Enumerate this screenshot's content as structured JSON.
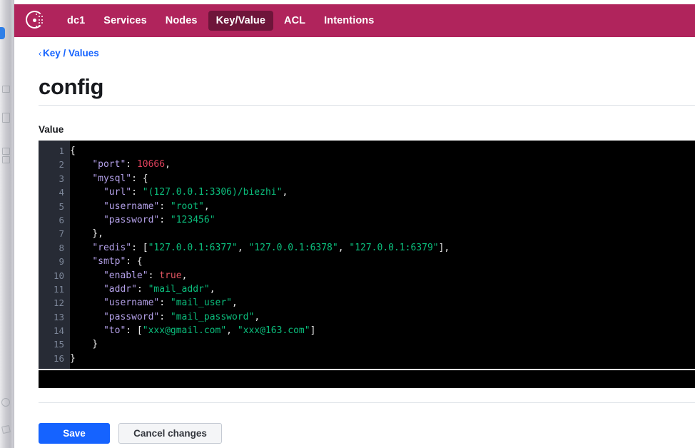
{
  "app": {
    "logo_icon": "consul-logo-icon",
    "brand_color": "#b0245c",
    "active_nav_color": "#6e153a",
    "accent_color": "#1563ff"
  },
  "nav": {
    "items": [
      {
        "label": "dc1",
        "active": false
      },
      {
        "label": "Services",
        "active": false
      },
      {
        "label": "Nodes",
        "active": false
      },
      {
        "label": "Key/Value",
        "active": true
      },
      {
        "label": "ACL",
        "active": false
      },
      {
        "label": "Intentions",
        "active": false
      }
    ]
  },
  "breadcrumb": {
    "chevron_icon": "chevron-left-icon",
    "label": "Key / Values"
  },
  "page": {
    "title": "config",
    "value_label": "Value"
  },
  "editor": {
    "background": "#000000",
    "gutter_background": "#272b35",
    "line_count": 16,
    "line_numbers": [
      "1",
      "2",
      "3",
      "4",
      "5",
      "6",
      "7",
      "8",
      "9",
      "10",
      "11",
      "12",
      "13",
      "14",
      "15",
      "16"
    ],
    "colors": {
      "punctuation": "#e8e8e8",
      "key": "#b3a0e8",
      "string": "#0bbf7d",
      "number": "#e0415c",
      "boolean": "#e05561",
      "line_number": "#7d8799"
    },
    "lines": [
      [
        {
          "t": "{",
          "c": "punc"
        }
      ],
      [
        {
          "t": "    ",
          "c": "punc"
        },
        {
          "t": "\"port\"",
          "c": "key"
        },
        {
          "t": ": ",
          "c": "punc"
        },
        {
          "t": "10666",
          "c": "num"
        },
        {
          "t": ",",
          "c": "punc"
        }
      ],
      [
        {
          "t": "    ",
          "c": "punc"
        },
        {
          "t": "\"mysql\"",
          "c": "key"
        },
        {
          "t": ": {",
          "c": "punc"
        }
      ],
      [
        {
          "t": "      ",
          "c": "punc"
        },
        {
          "t": "\"url\"",
          "c": "key"
        },
        {
          "t": ": ",
          "c": "punc"
        },
        {
          "t": "\"(127.0.0.1:3306)/biezhi\"",
          "c": "str"
        },
        {
          "t": ",",
          "c": "punc"
        }
      ],
      [
        {
          "t": "      ",
          "c": "punc"
        },
        {
          "t": "\"username\"",
          "c": "key"
        },
        {
          "t": ": ",
          "c": "punc"
        },
        {
          "t": "\"root\"",
          "c": "str"
        },
        {
          "t": ",",
          "c": "punc"
        }
      ],
      [
        {
          "t": "      ",
          "c": "punc"
        },
        {
          "t": "\"password\"",
          "c": "key"
        },
        {
          "t": ": ",
          "c": "punc"
        },
        {
          "t": "\"123456\"",
          "c": "str"
        }
      ],
      [
        {
          "t": "    },",
          "c": "punc"
        }
      ],
      [
        {
          "t": "    ",
          "c": "punc"
        },
        {
          "t": "\"redis\"",
          "c": "key"
        },
        {
          "t": ": [",
          "c": "punc"
        },
        {
          "t": "\"127.0.0.1:6377\"",
          "c": "str"
        },
        {
          "t": ", ",
          "c": "punc"
        },
        {
          "t": "\"127.0.0.1:6378\"",
          "c": "str"
        },
        {
          "t": ", ",
          "c": "punc"
        },
        {
          "t": "\"127.0.0.1:6379\"",
          "c": "str"
        },
        {
          "t": "],",
          "c": "punc"
        }
      ],
      [
        {
          "t": "    ",
          "c": "punc"
        },
        {
          "t": "\"smtp\"",
          "c": "key"
        },
        {
          "t": ": {",
          "c": "punc"
        }
      ],
      [
        {
          "t": "      ",
          "c": "punc"
        },
        {
          "t": "\"enable\"",
          "c": "key"
        },
        {
          "t": ": ",
          "c": "punc"
        },
        {
          "t": "true",
          "c": "bool"
        },
        {
          "t": ",",
          "c": "punc"
        }
      ],
      [
        {
          "t": "      ",
          "c": "punc"
        },
        {
          "t": "\"addr\"",
          "c": "key"
        },
        {
          "t": ": ",
          "c": "punc"
        },
        {
          "t": "\"mail_addr\"",
          "c": "str"
        },
        {
          "t": ",",
          "c": "punc"
        }
      ],
      [
        {
          "t": "      ",
          "c": "punc"
        },
        {
          "t": "\"username\"",
          "c": "key"
        },
        {
          "t": ": ",
          "c": "punc"
        },
        {
          "t": "\"mail_user\"",
          "c": "str"
        },
        {
          "t": ",",
          "c": "punc"
        }
      ],
      [
        {
          "t": "      ",
          "c": "punc"
        },
        {
          "t": "\"password\"",
          "c": "key"
        },
        {
          "t": ": ",
          "c": "punc"
        },
        {
          "t": "\"mail_password\"",
          "c": "str"
        },
        {
          "t": ",",
          "c": "punc"
        }
      ],
      [
        {
          "t": "      ",
          "c": "punc"
        },
        {
          "t": "\"to\"",
          "c": "key"
        },
        {
          "t": ": [",
          "c": "punc"
        },
        {
          "t": "\"xxx@gmail.com\"",
          "c": "str"
        },
        {
          "t": ", ",
          "c": "punc"
        },
        {
          "t": "\"xxx@163.com\"",
          "c": "str"
        },
        {
          "t": "]",
          "c": "punc"
        }
      ],
      [
        {
          "t": "    }",
          "c": "punc"
        }
      ],
      [
        {
          "t": "}",
          "c": "punc"
        }
      ]
    ]
  },
  "actions": {
    "save_label": "Save",
    "cancel_label": "Cancel changes"
  }
}
